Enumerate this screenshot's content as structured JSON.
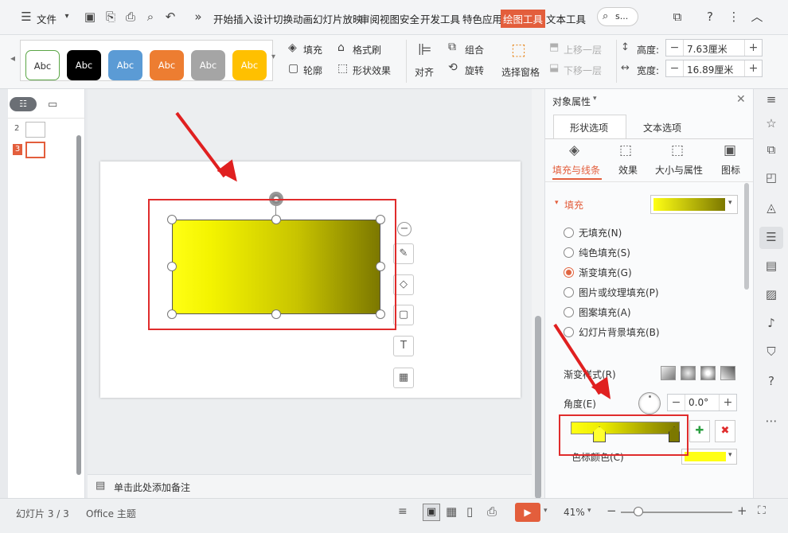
{
  "titlebar": {
    "file_label": "文件",
    "menu": [
      "开始",
      "插入",
      "设计",
      "切换",
      "动画",
      "幻灯片放映",
      "审阅",
      "视图",
      "安全",
      "开发工具",
      "特色应用",
      "绘图工具",
      "文本工具"
    ],
    "search_text": "s..."
  },
  "ribbon": {
    "styles": [
      "Abc",
      "Abc",
      "Abc",
      "Abc",
      "Abc",
      "Abc"
    ],
    "fill_label": "填充",
    "format_brush_label": "格式刷",
    "outline_label": "轮廓",
    "shape_effect_label": "形状效果",
    "align_label": "对齐",
    "group_label": "组合",
    "rotate_label": "旋转",
    "selection_pane_label": "选择窗格",
    "bring_forward_label": "上移一层",
    "send_backward_label": "下移一层",
    "height_label": "高度:",
    "height_value": "7.63厘米",
    "width_label": "宽度:",
    "width_value": "16.89厘米"
  },
  "slides": [
    {
      "num": "2"
    },
    {
      "num": "3"
    }
  ],
  "shape_tools": [
    "minus",
    "brush",
    "fill",
    "frame",
    "text",
    "layout"
  ],
  "notes_placeholder": "单击此处添加备注",
  "panel": {
    "title": "对象属性",
    "tabs": [
      "形状选项",
      "文本选项"
    ],
    "subtabs": [
      "填充与线条",
      "效果",
      "大小与属性",
      "图标"
    ],
    "section_fill": "填充",
    "fill_options": [
      "无填充(N)",
      "纯色填充(S)",
      "渐变填充(G)",
      "图片或纹理填充(P)",
      "图案填充(A)",
      "幻灯片背景填充(B)"
    ],
    "selected_fill": 2,
    "gradient_style_label": "渐变样式(R)",
    "angle_label": "角度(E)",
    "angle_value": "0.0°",
    "stop_color_label": "色标颜色(C)"
  },
  "statusbar": {
    "slide_counter": "幻灯片 3 / 3",
    "theme": "Office 主题",
    "zoom": "41%"
  },
  "colors": {
    "accent": "#e35e3c",
    "gradient_start": "#ffff14",
    "gradient_end": "#7c7800",
    "annotation_red": "#e02c2c"
  }
}
